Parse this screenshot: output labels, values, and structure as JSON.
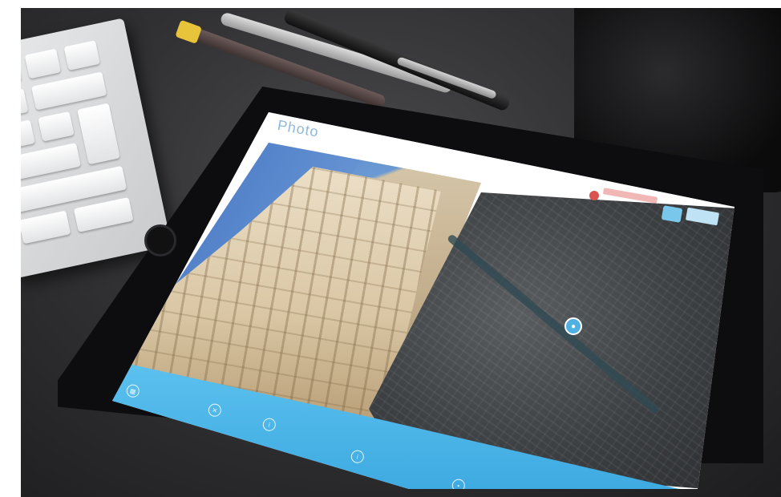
{
  "scene": {
    "description_objects": [
      "keyboard-icon",
      "pen-icon",
      "mug-icon",
      "tablet-icon"
    ]
  },
  "app": {
    "title": "Photo",
    "subtitle": ""
  },
  "map": {
    "pin_icon": "location-pin-icon"
  },
  "colors": {
    "toolbar": "#4db6e8",
    "accent_red": "#d9534f",
    "accent_blue": "#79c7ea",
    "sky": "#4a7bc4"
  }
}
